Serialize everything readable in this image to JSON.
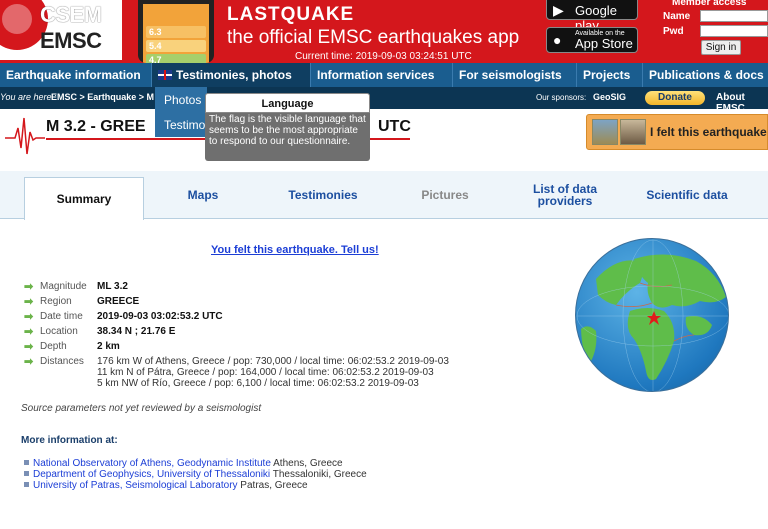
{
  "header": {
    "logo_top": "CSEM",
    "logo_bottom": "EMSC",
    "app_title": "LASTQUAKE",
    "app_subtitle": "the official EMSC earthquakes app",
    "current_time": "Current time: 2019-09-03 03:24:51 UTC",
    "phone_rows": [
      "6.3",
      "5.4",
      "4.7"
    ],
    "google_play_small": "",
    "google_play_big": "Google play",
    "appstore_small": "Available on the",
    "appstore_big": "App Store",
    "member_access": "Member access",
    "name_label": "Name",
    "pwd_label": "Pwd",
    "signin_label": "Sign in"
  },
  "nav": {
    "items": [
      {
        "label": "Earthquake information"
      },
      {
        "label": "Testimonies, photos"
      },
      {
        "label": "Information services"
      },
      {
        "label": "For seismologists"
      },
      {
        "label": "Projects"
      },
      {
        "label": "Publications & docs"
      }
    ]
  },
  "breadcrumb": {
    "prefix": "You are here :",
    "path": "EMSC > Earthquake > M 3",
    "sponsors_label": "Our sponsors:",
    "sponsor": "GeoSIG",
    "donate": "Donate",
    "about": "About EMSC"
  },
  "dropdown": {
    "items": [
      "Photos",
      "Testimo"
    ]
  },
  "tooltip": {
    "title": "Language",
    "body": "The flag is the visible language that seems to be the most appropriate to respond to our questionnaire."
  },
  "title": {
    "text": "M 3.2 - GREE",
    "utc": "UTC"
  },
  "felt_button": "I felt this earthquake",
  "tabs": [
    {
      "label": "Summary"
    },
    {
      "label": "Maps"
    },
    {
      "label": "Testimonies"
    },
    {
      "label": "Pictures"
    },
    {
      "label": "List of data providers"
    },
    {
      "label": "Scientific data"
    }
  ],
  "felt_link": "You felt this earthquake. Tell us!",
  "params": [
    {
      "label": "Magnitude",
      "value": "ML 3.2"
    },
    {
      "label": "Region",
      "value": "GREECE"
    },
    {
      "label": "Date time",
      "value": "2019-09-03 03:02:53.2 UTC"
    },
    {
      "label": "Location",
      "value": "38.34 N ; 21.76 E"
    },
    {
      "label": "Depth",
      "value": "2 km"
    },
    {
      "label": "Distances",
      "value": ""
    }
  ],
  "distances": [
    "176 km W of Athens, Greece / pop: 730,000 / local time: 06:02:53.2 2019-09-03",
    "11 km N of Pátra, Greece / pop: 164,000 / local time: 06:02:53.2 2019-09-03",
    "5 km NW of Río, Greece / pop: 6,100 / local time: 06:02:53.2 2019-09-03"
  ],
  "review_note": "Source parameters not yet reviewed by a seismologist",
  "more_info": "More information at:",
  "links": [
    {
      "link": "National Observatory of Athens, Geodynamic Institute",
      "rest": " Athens, Greece"
    },
    {
      "link": "Department of Geophysics, University of Thessaloniki",
      "rest": " Thessaloniki, Greece"
    },
    {
      "link": "University of Patras, Seismological Laboratory",
      "rest": " Patras, Greece"
    }
  ],
  "colors": {
    "header_red": "#d4171c",
    "nav_blue": "#1a5d8f",
    "crumb_dark": "#0c3553",
    "link_blue": "#1c3ed6",
    "felt_orange": "#f4ab52"
  },
  "icons": [
    "android-icon",
    "apple-icon",
    "uk-flag-icon",
    "arrow-bullet-icon",
    "seismogram-icon",
    "globe-map-icon",
    "epicenter-star-icon"
  ]
}
